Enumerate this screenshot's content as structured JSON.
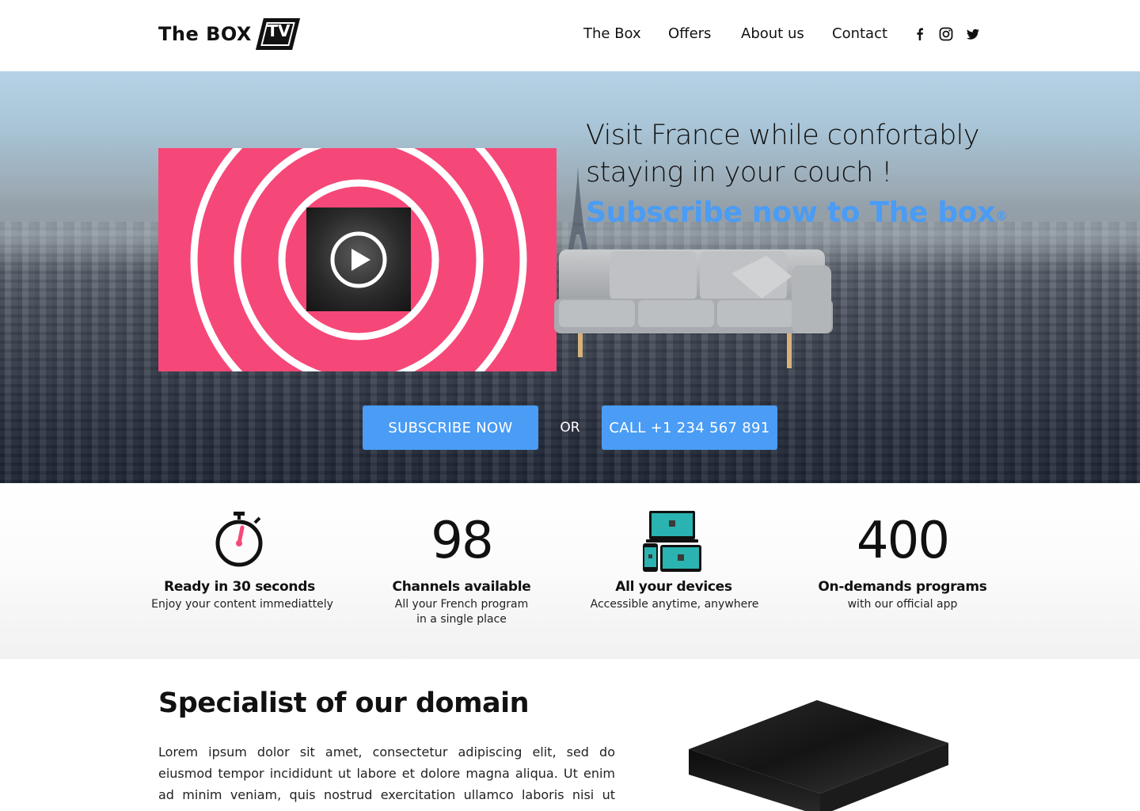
{
  "header": {
    "logo_text": "The BOX",
    "logo_badge": "TV",
    "nav": [
      {
        "label": "The Box"
      },
      {
        "label": "Offers"
      },
      {
        "label": "About us"
      },
      {
        "label": "Contact"
      }
    ],
    "social_icons": [
      "facebook-icon",
      "instagram-icon",
      "twitter-icon"
    ]
  },
  "hero": {
    "title": "Visit France while confortably staying in your couch !",
    "subtitle": "Subscribe now to The box",
    "subtitle_mark": "®",
    "subscribe_button": "SUBSCRIBE NOW",
    "or_label": "OR",
    "call_button": "CALL +1 234 567 891",
    "video_icon": "play-icon"
  },
  "features": [
    {
      "icon": "stopwatch-icon",
      "title": "Ready in 30 seconds",
      "desc": "Enjoy your content immediattely"
    },
    {
      "number": "98",
      "title": "Channels available",
      "desc": "All your French program",
      "desc2": "in a single place"
    },
    {
      "icon": "devices-icon",
      "title": "All your devices",
      "desc": "Accessible anytime, anywhere"
    },
    {
      "number": "400",
      "title": "On-demands programs",
      "desc": "with our official app"
    }
  ],
  "specialist": {
    "title": "Specialist of our domain",
    "text": "Lorem ipsum dolor sit amet, consectetur adipiscing elit, sed do eiusmod tempor incididunt ut labore et dolore magna aliqua. Ut enim ad minim veniam, quis nostrud exercitation ullamco laboris nisi ut aliquip ex ea commodo consequat. Duis aute irure dolor in reprehenderit."
  },
  "colors": {
    "accent_blue": "#4a9cf5",
    "video_pink": "#f54878",
    "text_dark": "#111111"
  }
}
